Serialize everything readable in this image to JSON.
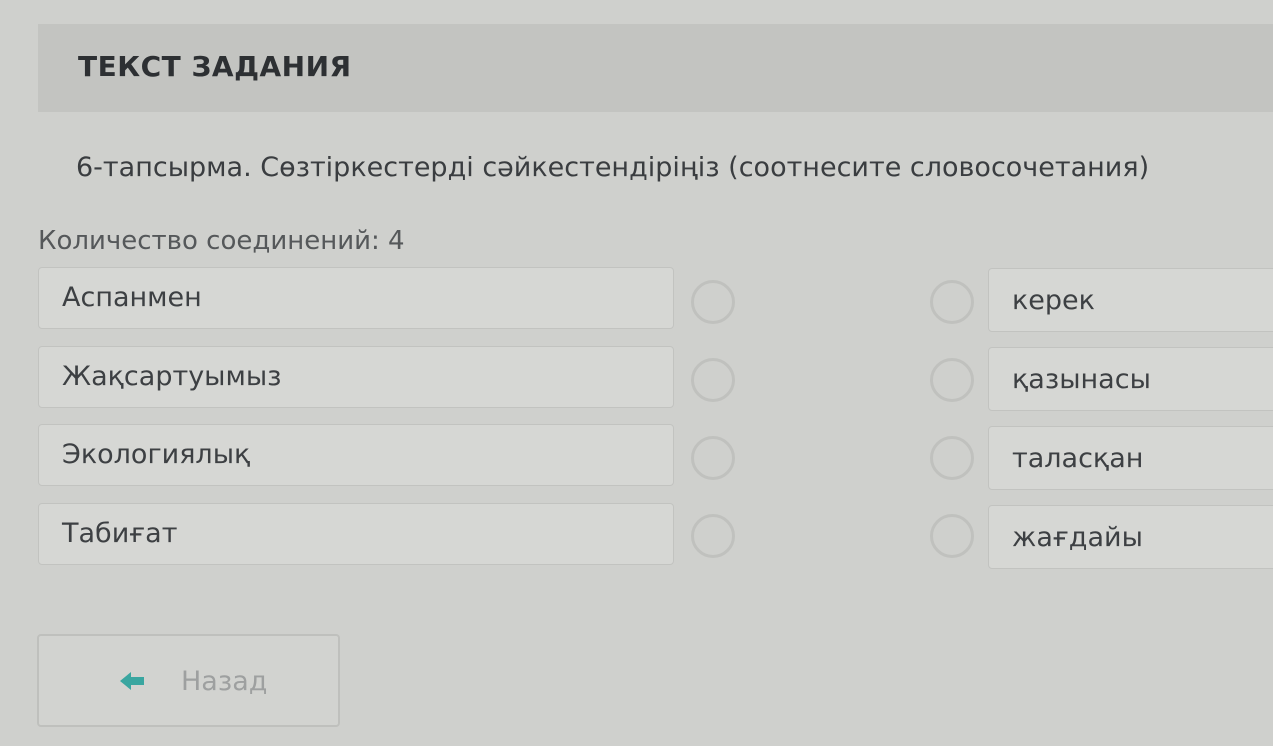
{
  "header": {
    "title": "ТЕКСТ ЗАДАНИЯ"
  },
  "task": {
    "text": "6-тапсырма. Сөзтіркестерді сәйкестендіріңіз (соотнесите словосочетания)"
  },
  "connections": {
    "label": "Количество соединений: 4"
  },
  "left_items": [
    {
      "label": "Аспанмен"
    },
    {
      "label": "Жақсартуымыз"
    },
    {
      "label": "Экологиялық"
    },
    {
      "label": "Табиғат"
    }
  ],
  "right_items": [
    {
      "label": "керек"
    },
    {
      "label": "қазынасы"
    },
    {
      "label": "таласқан"
    },
    {
      "label": "жағдайы"
    }
  ],
  "back_button": {
    "label": "Назад",
    "icon": "arrow-left-icon"
  },
  "colors": {
    "accent": "#3aa6a0"
  }
}
